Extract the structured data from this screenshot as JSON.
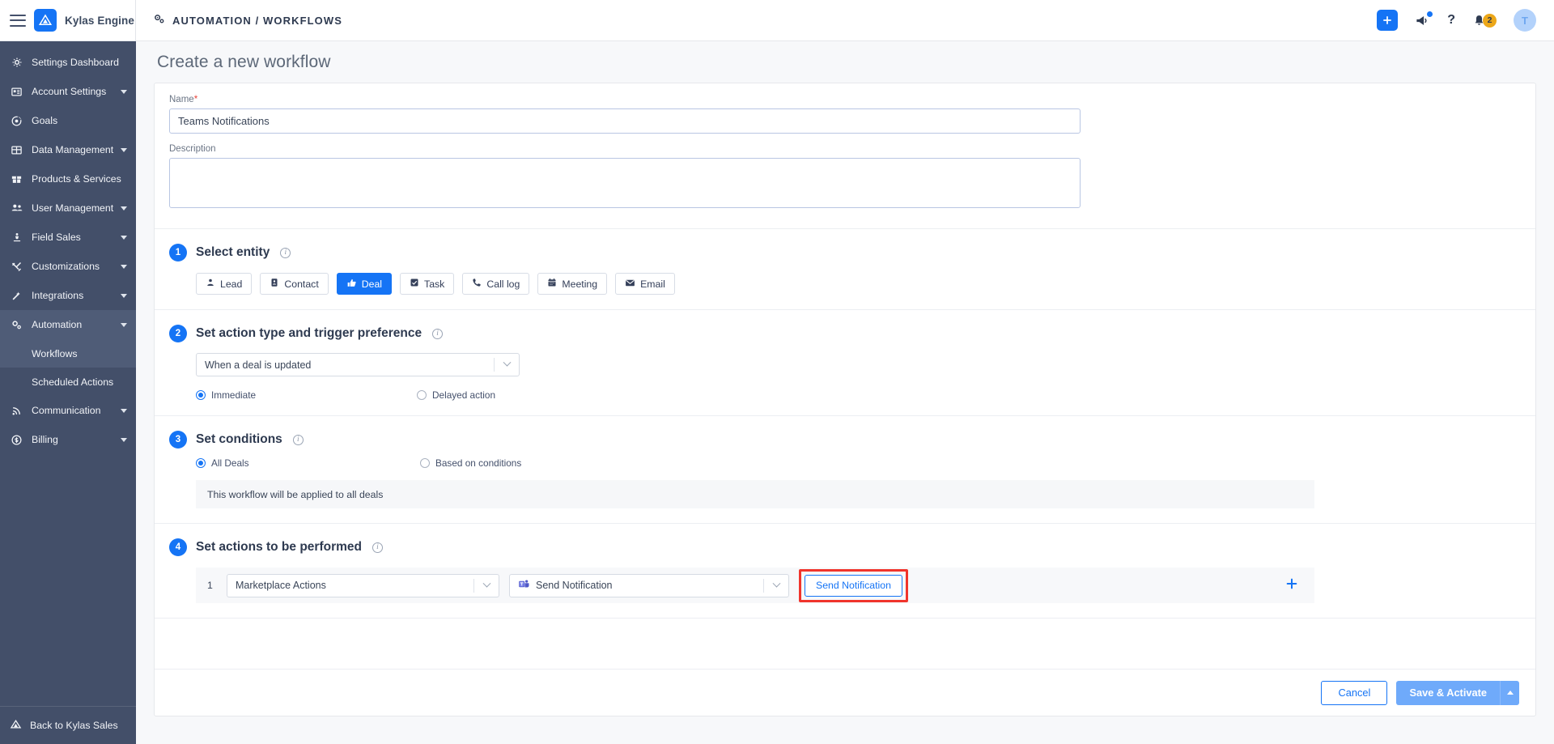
{
  "topbar": {
    "brand": "Kylas Engine",
    "breadcrumb": "AUTOMATION / WORKFLOWS",
    "menu_icon": "hamburger-icon",
    "settings_icon": "gears-icon",
    "add_icon": "plus-icon",
    "announce_icon": "megaphone-icon",
    "help_icon": "question-mark-icon",
    "help_label": "?",
    "bell_icon": "bell-icon",
    "notification_count": "2",
    "avatar_initial": "T",
    "accent": "#1574f5",
    "badge_color": "#eca719"
  },
  "sidebar": {
    "items": [
      {
        "label": "Settings Dashboard",
        "icon": "gear-icon",
        "caret": false,
        "active": false
      },
      {
        "label": "Account Settings",
        "icon": "id-card-icon",
        "caret": true,
        "active": false
      },
      {
        "label": "Goals",
        "icon": "target-icon",
        "caret": false,
        "active": false
      },
      {
        "label": "Data Management",
        "icon": "grid-icon",
        "caret": true,
        "active": false
      },
      {
        "label": "Products & Services",
        "icon": "box-icon",
        "caret": false,
        "active": false
      },
      {
        "label": "User Management",
        "icon": "users-icon",
        "caret": true,
        "active": false
      },
      {
        "label": "Field Sales",
        "icon": "pin-person-icon",
        "caret": true,
        "active": false
      },
      {
        "label": "Customizations",
        "icon": "tools-icon",
        "caret": true,
        "active": false
      },
      {
        "label": "Integrations",
        "icon": "wand-icon",
        "caret": true,
        "active": false
      },
      {
        "label": "Automation",
        "icon": "gears-icon",
        "caret": true,
        "active": true
      }
    ],
    "sub_items": [
      {
        "label": "Workflows",
        "active": true
      },
      {
        "label": "Scheduled Actions",
        "active": false
      }
    ],
    "tail_items": [
      {
        "label": "Communication",
        "icon": "signal-icon",
        "caret": true
      },
      {
        "label": "Billing",
        "icon": "dollar-circle-icon",
        "caret": true
      }
    ],
    "back_label": "Back to Kylas Sales",
    "back_icon": "kylas-mark-icon",
    "bg": "#434f69",
    "active_bg": "#4f5c77"
  },
  "page": {
    "title": "Create a new workflow"
  },
  "form": {
    "name_label": "Name",
    "name_required": "*",
    "name_value": "Teams Notifications",
    "name_placeholder": "",
    "description_label": "Description",
    "description_value": "",
    "description_placeholder": ""
  },
  "sections": {
    "entity": {
      "step": "1",
      "title": "Select entity",
      "info_icon": "info-icon",
      "chips": [
        {
          "label": "Lead",
          "icon": "person-icon",
          "selected": false
        },
        {
          "label": "Contact",
          "icon": "contact-card-icon",
          "selected": false
        },
        {
          "label": "Deal",
          "icon": "thumbs-up-icon",
          "selected": true
        },
        {
          "label": "Task",
          "icon": "checkbox-icon",
          "selected": false
        },
        {
          "label": "Call log",
          "icon": "phone-icon",
          "selected": false
        },
        {
          "label": "Meeting",
          "icon": "calendar-icon",
          "selected": false
        },
        {
          "label": "Email",
          "icon": "envelope-icon",
          "selected": false
        }
      ]
    },
    "trigger": {
      "step": "2",
      "title": "Set action type and trigger preference",
      "info_icon": "info-icon",
      "select_value": "When a deal is updated",
      "radios": [
        {
          "label": "Immediate",
          "selected": true
        },
        {
          "label": "Delayed action",
          "selected": false
        }
      ]
    },
    "conditions": {
      "step": "3",
      "title": "Set conditions",
      "info_icon": "info-icon",
      "radios": [
        {
          "label": "All Deals",
          "selected": true
        },
        {
          "label": "Based on conditions",
          "selected": false
        }
      ],
      "notice": "This workflow will be applied to all deals"
    },
    "actions": {
      "step": "4",
      "title": "Set actions to be performed",
      "info_icon": "info-icon",
      "row_index": "1",
      "action_category": "Marketplace Actions",
      "action_type": "Send Notification",
      "action_type_icon": "microsoft-teams-icon",
      "send_button": "Send Notification",
      "add_icon": "plus-icon",
      "highlight_color": "#f0342c"
    }
  },
  "footer": {
    "cancel_label": "Cancel",
    "save_label": "Save & Activate",
    "save_caret_icon": "caret-up-icon"
  }
}
